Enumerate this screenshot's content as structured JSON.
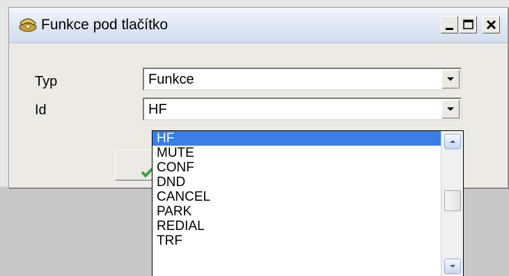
{
  "window": {
    "title": "Funkce pod tlačítko",
    "controls": {
      "minimize": "minimize",
      "maximize": "maximize",
      "close": "close"
    }
  },
  "form": {
    "typ_label": "Typ",
    "typ_value": "Funkce",
    "id_label": "Id",
    "id_value": "HF"
  },
  "dropdown": {
    "items": [
      "HF",
      "MUTE",
      "CONF",
      "DND",
      "CANCEL",
      "PARK",
      "REDIAL",
      "TRF"
    ],
    "selected": "HF"
  },
  "colors": {
    "selection": "#3a7ee6",
    "ok_check": "#3aa53a"
  },
  "icons": {
    "title_icon": "telephone-icon",
    "ok_icon": "check-icon"
  }
}
